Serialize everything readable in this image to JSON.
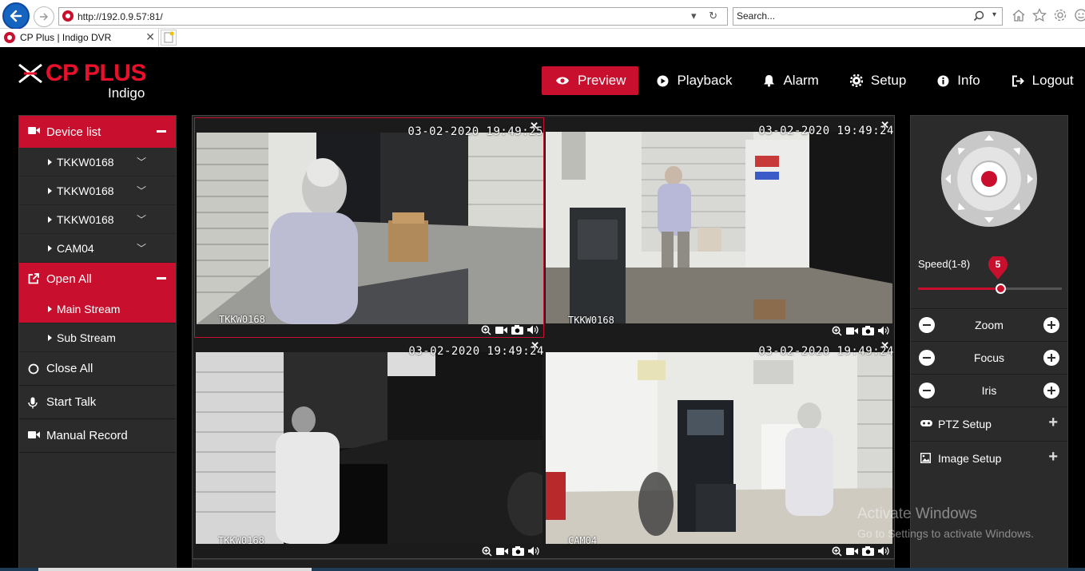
{
  "browser": {
    "url": "http://192.0.9.57:81/",
    "search_placeholder": "Search...",
    "tab_title": "CP Plus | Indigo DVR"
  },
  "logo": {
    "brand": "CP PLUS",
    "sub": "Indigo"
  },
  "nav": [
    {
      "label": "Preview",
      "icon": "eye-icon",
      "active": true
    },
    {
      "label": "Playback",
      "icon": "play-circle-icon"
    },
    {
      "label": "Alarm",
      "icon": "bell-icon"
    },
    {
      "label": "Setup",
      "icon": "gear-icon"
    },
    {
      "label": "Info",
      "icon": "info-icon"
    },
    {
      "label": "Logout",
      "icon": "logout-icon"
    }
  ],
  "left_panel": {
    "device_list_label": "Device list",
    "devices": [
      "TKKW0168",
      "TKKW0168",
      "TKKW0168",
      "CAM04"
    ],
    "open_all_label": "Open All",
    "streams": [
      "Main Stream",
      "Sub Stream"
    ],
    "close_all_label": "Close All",
    "start_talk_label": "Start Talk",
    "manual_record_label": "Manual Record"
  },
  "cameras": [
    {
      "name": "TKKW0168",
      "timestamp": "03-02-2020 19:49:25",
      "selected": true,
      "scene": "color-entry"
    },
    {
      "name": "TKKW0168",
      "timestamp": "03-02-2020 19:49:24",
      "selected": false,
      "scene": "color-atm-room"
    },
    {
      "name": "TKKW0168",
      "timestamp": "03-02-2020 19:49:24",
      "selected": false,
      "scene": "night-bw"
    },
    {
      "name": "CAM04",
      "timestamp": "03-02-2020 19:49:24",
      "selected": false,
      "scene": "color-atm-kiosk"
    }
  ],
  "ptz": {
    "speed_label": "Speed(1-8)",
    "speed_value": "5",
    "speed_fraction": 0.57,
    "controls": [
      "Zoom",
      "Focus",
      "Iris"
    ],
    "ptz_setup_label": "PTZ Setup",
    "image_setup_label": "Image Setup"
  },
  "watermark": {
    "line1": "Activate Windows",
    "line2": "Go to Settings to activate Windows."
  },
  "colors": {
    "accent": "#c8102e",
    "panel": "#2b2b2b"
  }
}
